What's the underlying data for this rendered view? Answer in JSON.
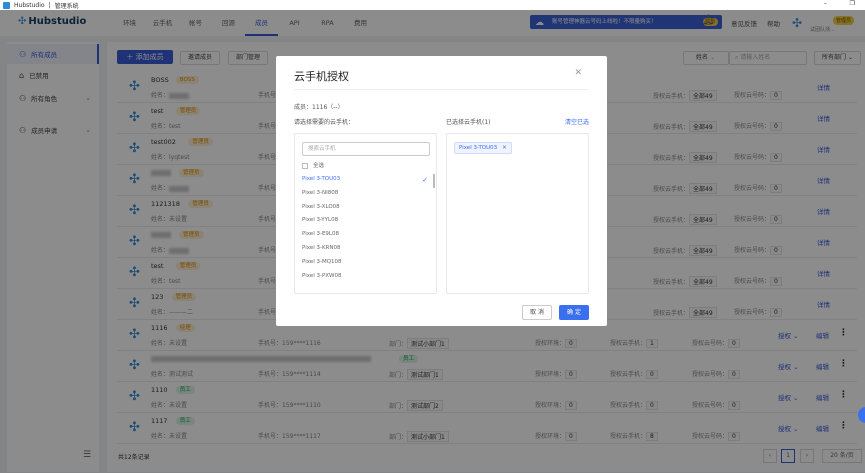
{
  "window": {
    "app": "Hubstudio",
    "subtitle": "管理系统"
  },
  "brand": "Hubstudio",
  "nav": [
    {
      "label": "环境"
    },
    {
      "label": "云手机"
    },
    {
      "label": "帐号"
    },
    {
      "label": "回源"
    },
    {
      "label": "成员",
      "active": true
    },
    {
      "label": "API"
    },
    {
      "label": "RPA"
    },
    {
      "label": "费用"
    }
  ],
  "banner": {
    "text": "账号管理神器云号码上线啦！不限量购买！",
    "tag": "抢购"
  },
  "header_links": {
    "feedback": "意见反馈",
    "help": "帮助"
  },
  "user": {
    "badge": "管理员",
    "team": "试团队测..."
  },
  "sidebar": [
    {
      "label": "所有成员",
      "icon": "user-icon",
      "active": true
    },
    {
      "label": "已禁用",
      "icon": "lock-icon"
    },
    {
      "label": "所有角色",
      "icon": "role-icon",
      "chevron": true
    },
    {
      "label": "成员申请",
      "icon": "user-icon",
      "chevron": true
    }
  ],
  "toolbar": {
    "add": "添加成员",
    "invite": "邀请成员",
    "dept": "部门管理",
    "filter_field": "姓名",
    "search_placeholder": "请输入姓名",
    "dept_filter": "所有部门"
  },
  "labels": {
    "name": "姓名：",
    "phone": "手机号：",
    "dept": "部门：",
    "env": "授权环境：",
    "cloud": "授权云手机：",
    "number": "授权云号码：",
    "detail": "详情",
    "auth": "授权",
    "edit": "编辑"
  },
  "members": [
    {
      "name": "BOSS",
      "role": "BOSS",
      "color": "orange",
      "realname": "",
      "cloud": "全部49",
      "number": "0",
      "admin": true
    },
    {
      "name": "test",
      "role": "管理员",
      "color": "orange",
      "realname": "test",
      "cloud": "全部49",
      "number": "0",
      "admin": true
    },
    {
      "name": "test002",
      "role": "管理员",
      "color": "orange",
      "realname": "lyqtest",
      "cloud": "全部49",
      "number": "0",
      "admin": true
    },
    {
      "name": "",
      "role": "管理员",
      "color": "orange",
      "realname": "",
      "cloud": "全部49",
      "number": "0",
      "admin": true
    },
    {
      "name": "1121318",
      "role": "管理员",
      "color": "orange",
      "realname": "未设置",
      "cloud": "全部49",
      "number": "0",
      "admin": true
    },
    {
      "name": "",
      "role": "管理员",
      "color": "orange",
      "realname": "",
      "cloud": "全部49",
      "number": "0",
      "admin": true
    },
    {
      "name": "test",
      "role": "管理员",
      "color": "orange",
      "realname": "test",
      "cloud": "全部49",
      "number": "0",
      "admin": true
    },
    {
      "name": "123",
      "role": "管理员",
      "color": "orange",
      "realname": "———二",
      "cloud": "全部49",
      "number": "0",
      "admin": true
    },
    {
      "name": "1116",
      "role": "经理",
      "color": "orange",
      "realname": "未设置",
      "phone": "159****1116",
      "dept": "测试小部门1",
      "env": "0",
      "cloud": "1",
      "number": "0"
    },
    {
      "name": "",
      "role": "员工",
      "color": "green",
      "realname": "测试测试",
      "phone": "159****1114",
      "dept": "测试部门1",
      "env": "0",
      "cloud": "0",
      "number": "0"
    },
    {
      "name": "1110",
      "role": "员工",
      "color": "green",
      "realname": "未设置",
      "phone": "159****1110",
      "dept": "测试部门2",
      "env": "0",
      "cloud": "0",
      "number": "0"
    },
    {
      "name": "1117",
      "role": "员工",
      "color": "green",
      "realname": "未设置",
      "phone": "159****1117",
      "dept": "测试小部门1",
      "env": "0",
      "cloud": "8",
      "number": "0"
    }
  ],
  "footer": {
    "total": "共12条记录",
    "page": "1",
    "page_size": "20 条/页"
  },
  "modal": {
    "title": "云手机授权",
    "member": "成员：1116（--）",
    "left_label": "请选择需要的云手机：",
    "right_label": "已选择云手机(1)",
    "clear": "清空已选",
    "search_placeholder": "搜索云手机",
    "select_all": "全选",
    "options": [
      {
        "label": "Pixel 3-TOU03",
        "selected": true
      },
      {
        "label": "Pixel 3-NI808"
      },
      {
        "label": "Pixel 3-XLO08"
      },
      {
        "label": "Pixel 3-YYL08"
      },
      {
        "label": "Pixel 3-E9L08"
      },
      {
        "label": "Pixel 3-KRN08"
      },
      {
        "label": "Pixel 3-MQ108"
      },
      {
        "label": "Pixel 3-PXW08"
      }
    ],
    "chips": [
      "Pixel 3-TOU03"
    ],
    "cancel": "取 消",
    "ok": "确 定"
  },
  "colors": {
    "primary": "#3a5bd8",
    "modal_primary": "#3a6ff0"
  }
}
